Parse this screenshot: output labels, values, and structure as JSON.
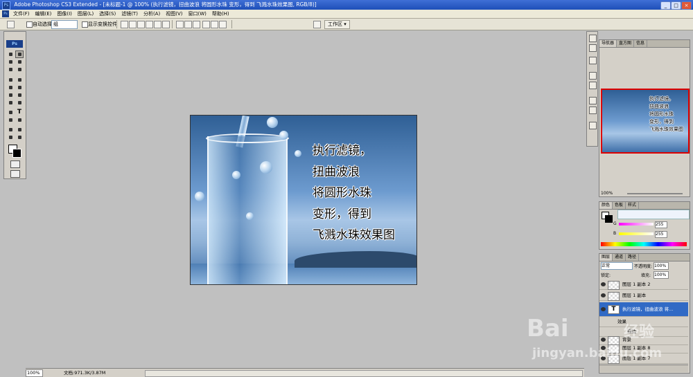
{
  "titlebar": {
    "title": "Adobe Photoshop CS3 Extended - [未标题-1 @ 100% (执行滤镜，扭曲波浪 将圆形水珠 变形，得到 飞溅水珠效果图, RGB/8)]",
    "app_icon": "Ps",
    "buttons": [
      "_",
      "□",
      "×"
    ]
  },
  "menubar": {
    "items": [
      "文件(F)",
      "编辑(E)",
      "图像(I)",
      "图层(L)",
      "选择(S)",
      "滤镜(T)",
      "分析(A)",
      "视图(V)",
      "窗口(W)",
      "帮助(H)"
    ]
  },
  "options": {
    "auto_select_label": "自动选择:",
    "auto_select_value": "组",
    "show_transform_label": "显示变换控件",
    "workspace_label": "工作区 ▾"
  },
  "toolbox": {
    "logo": "Ps"
  },
  "document": {
    "lines": [
      "执行滤镜，",
      "扭曲波浪",
      "将圆形水珠",
      "变形，得到",
      "飞溅水珠效果图"
    ]
  },
  "status": {
    "zoom": "100%",
    "doc_info": "文档:971.3K/3.87M"
  },
  "navigator": {
    "tabs": [
      "导航器",
      "直方图",
      "信息"
    ],
    "zoom": "100%",
    "thumb_lines": [
      "执行滤镜，",
      "扭曲波浪",
      "将圆形水珠",
      "变形，得到",
      "飞溅水珠效果图"
    ]
  },
  "color_panel": {
    "tabs": [
      "颜色",
      "色板",
      "样式"
    ],
    "g_label": "G",
    "g_value": "255",
    "b_label": "B",
    "b_value": "255"
  },
  "layers_panel": {
    "tabs": [
      "图层",
      "通道",
      "路径"
    ],
    "blend_mode": "正常",
    "opacity_label": "不透明度:",
    "opacity_value": "100%",
    "lock_label": "锁定:",
    "fill_label": "填充:",
    "fill_value": "100%",
    "layers": [
      {
        "name": "图层 1 副本 2"
      },
      {
        "name": "图层 1 副本"
      },
      {
        "name": "执行滤镜，扭曲波浪 将..."
      },
      {
        "name": "效果"
      },
      {
        "name": "描边"
      },
      {
        "name": "背景"
      },
      {
        "name": "图层 1 副本 8"
      },
      {
        "name": "图层 1 副本 7"
      }
    ]
  },
  "watermark": {
    "brand": "Bai",
    "brand2": "经验",
    "url": "jingyan.baidu.com"
  }
}
